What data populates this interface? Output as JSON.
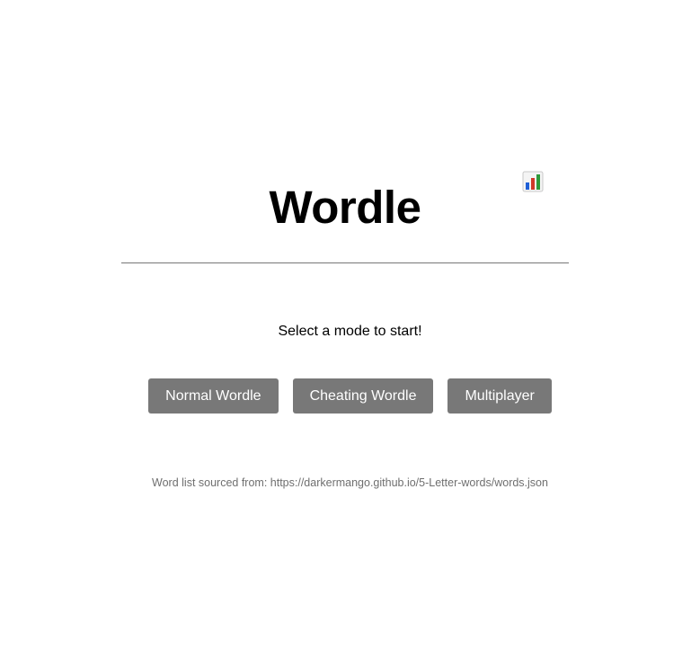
{
  "header": {
    "title": "Wordle",
    "stats_icon": "bar-chart-icon"
  },
  "main": {
    "prompt": "Select a mode to start!",
    "modes": [
      {
        "label": "Normal Wordle"
      },
      {
        "label": "Cheating Wordle"
      },
      {
        "label": "Multiplayer"
      }
    ]
  },
  "footer": {
    "source_text": "Word list sourced from: https://darkermango.github.io/5-Letter-words/words.json"
  },
  "colors": {
    "button_bg": "#787878",
    "button_text": "#ffffff",
    "divider": "#777777",
    "footer_text": "#6f6f6f",
    "chart_bar_blue": "#1f5fd6",
    "chart_bar_red": "#d03a2a",
    "chart_bar_green": "#2e9a3a"
  }
}
